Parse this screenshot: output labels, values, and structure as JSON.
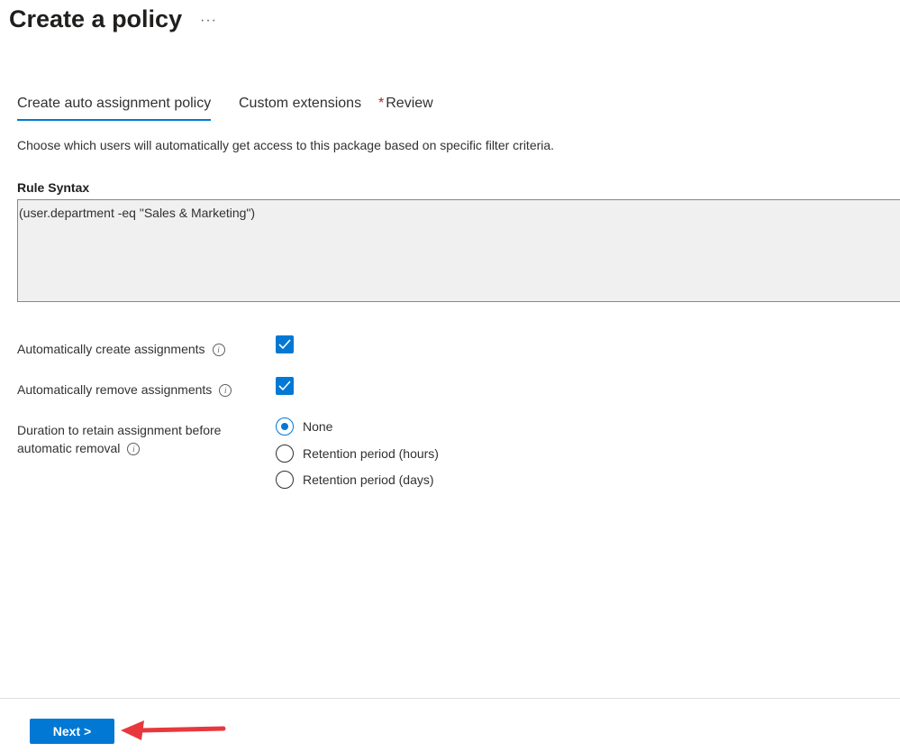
{
  "header": {
    "title": "Create a policy",
    "more_label": "···"
  },
  "tabs": [
    {
      "label": "Create auto assignment policy",
      "active": true,
      "required": false
    },
    {
      "label": "Custom extensions",
      "active": false,
      "required": false
    },
    {
      "label": "Review",
      "active": false,
      "required": true,
      "required_marker": "*"
    }
  ],
  "description": "Choose which users will automatically get access to this package based on specific filter criteria.",
  "rule": {
    "label": "Rule Syntax",
    "value": "(user.department -eq \"Sales & Marketing\")"
  },
  "settings": {
    "auto_create": {
      "label": "Automatically create assignments",
      "checked": true
    },
    "auto_remove": {
      "label": "Automatically remove assignments",
      "checked": true
    },
    "retention": {
      "label_line1": "Duration to retain assignment before",
      "label_line2": "automatic removal",
      "options": [
        {
          "label": "None",
          "selected": true
        },
        {
          "label": "Retention period (hours)",
          "selected": false
        },
        {
          "label": "Retention period (days)",
          "selected": false
        }
      ]
    }
  },
  "info_glyph": "i",
  "footer": {
    "next_label": "Next >"
  },
  "colors": {
    "accent": "#0078d4",
    "arrow": "#e8383d",
    "required": "#a4262c"
  }
}
